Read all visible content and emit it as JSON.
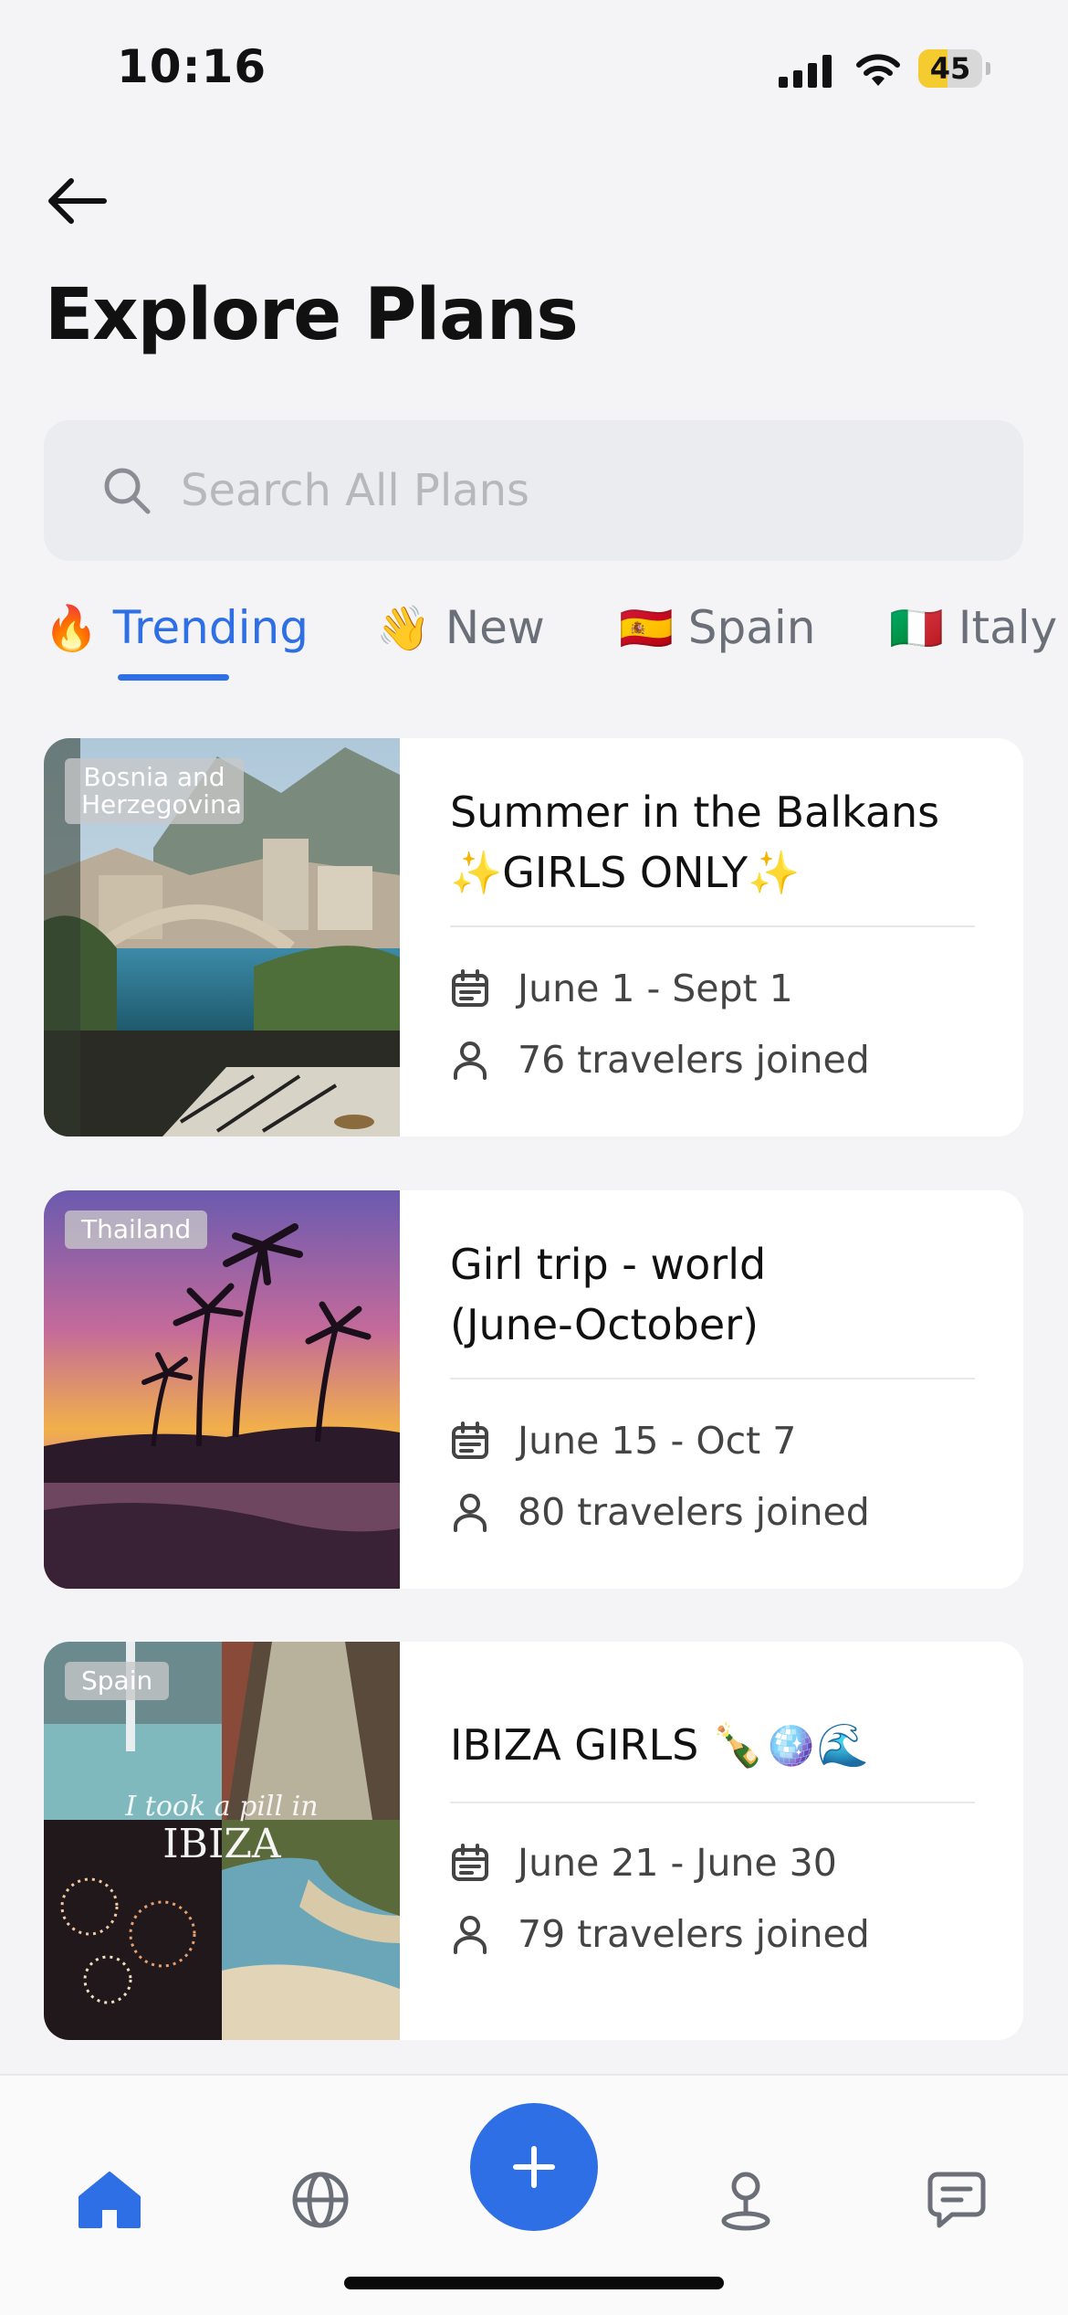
{
  "status_bar": {
    "time": "10:16",
    "battery": "45",
    "battery_level": 0.45
  },
  "page": {
    "title": "Explore Plans"
  },
  "search": {
    "placeholder": "Search All Plans"
  },
  "tabs": [
    {
      "emoji": "🔥",
      "label": "Trending",
      "active": true
    },
    {
      "emoji": "👋",
      "label": "New",
      "active": false
    },
    {
      "emoji": "🇪🇸",
      "label": "Spain",
      "active": false
    },
    {
      "emoji": "🇮🇹",
      "label": "Italy",
      "active": false
    }
  ],
  "plans": [
    {
      "location": "Bosnia and Herzegovina",
      "title_line1": "Summer in the Balkans",
      "title_line2": "✨GIRLS ONLY✨",
      "dates": "June 1 - Sept 1",
      "travelers": "76 travelers joined"
    },
    {
      "location": "Thailand",
      "title_line1": "Girl trip - world",
      "title_line2": "(June-October)",
      "dates": "June 15 - Oct 7",
      "travelers": "80 travelers joined"
    },
    {
      "location": "Spain",
      "title_line1": "IBIZA GIRLS 🍾🪩🌊",
      "title_line2": "",
      "dates": "June 21 - June 30",
      "travelers": "79 travelers joined"
    }
  ],
  "bottom_nav": [
    {
      "icon": "home-icon",
      "active": true
    },
    {
      "icon": "globe-icon",
      "active": false
    },
    {
      "icon": "plus-icon",
      "active": false
    },
    {
      "icon": "location-pin-icon",
      "active": false
    },
    {
      "icon": "chat-icon",
      "active": false
    }
  ],
  "colors": {
    "accent": "#2f6fe6",
    "background": "#f4f4f6",
    "card": "#ffffff",
    "muted": "#6b6f78"
  }
}
